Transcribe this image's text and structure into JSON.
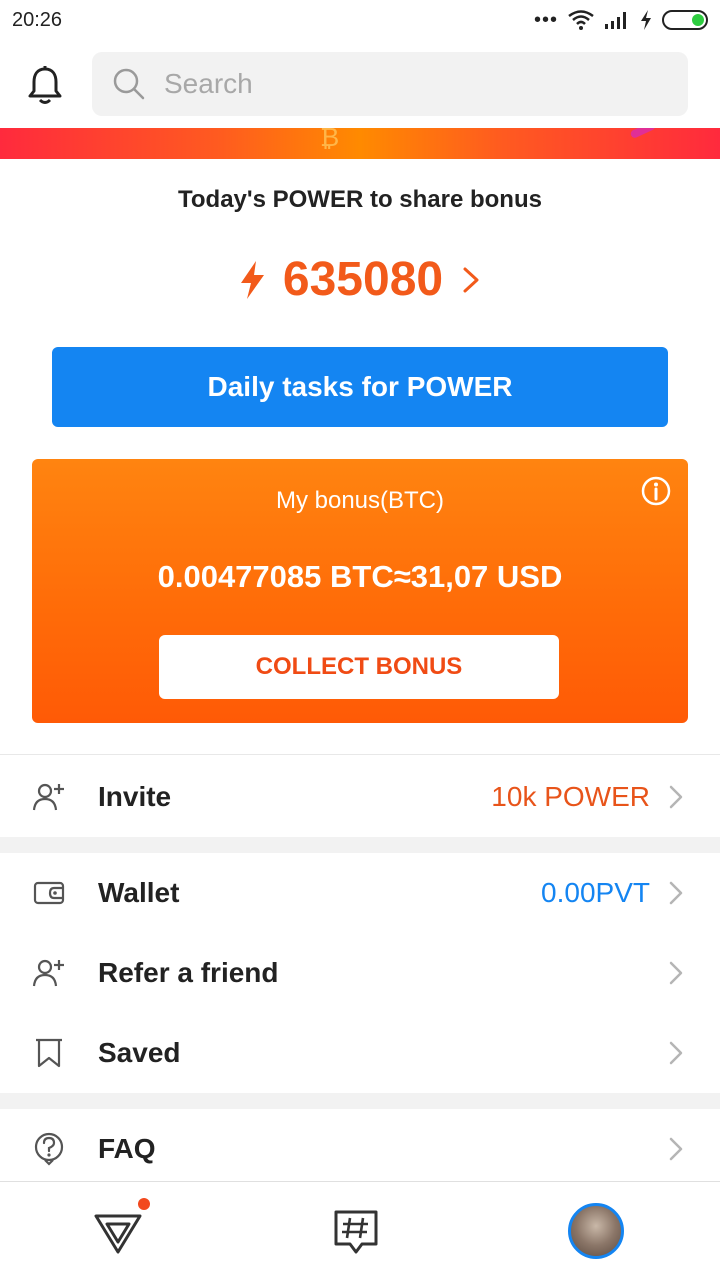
{
  "status_bar": {
    "time": "20:26"
  },
  "header": {
    "search_placeholder": "Search"
  },
  "share": {
    "title": "Today's POWER to share bonus",
    "power_value": "635080"
  },
  "daily_button": {
    "label": "Daily tasks for POWER"
  },
  "bonus_card": {
    "label": "My bonus(BTC)",
    "amount": "0.00477085 BTC≈31,07 USD",
    "collect_label": "COLLECT BONUS"
  },
  "menu": {
    "invite": {
      "label": "Invite",
      "value": "10k POWER"
    },
    "wallet": {
      "label": "Wallet",
      "value": "0.00PVT"
    },
    "refer": {
      "label": "Refer a friend"
    },
    "saved": {
      "label": "Saved"
    },
    "faq": {
      "label": "FAQ"
    }
  },
  "colors": {
    "accent_blue": "#1485f2",
    "accent_orange": "#f25a1a",
    "card_orange": "#ff6a08"
  },
  "icons": [
    "bell-icon",
    "search-icon",
    "bolt-icon",
    "chevron-right-icon",
    "info-icon",
    "add-user-icon",
    "wallet-icon",
    "bookmark-icon",
    "help-icon",
    "home-icon",
    "hashtag-icon",
    "avatar"
  ]
}
